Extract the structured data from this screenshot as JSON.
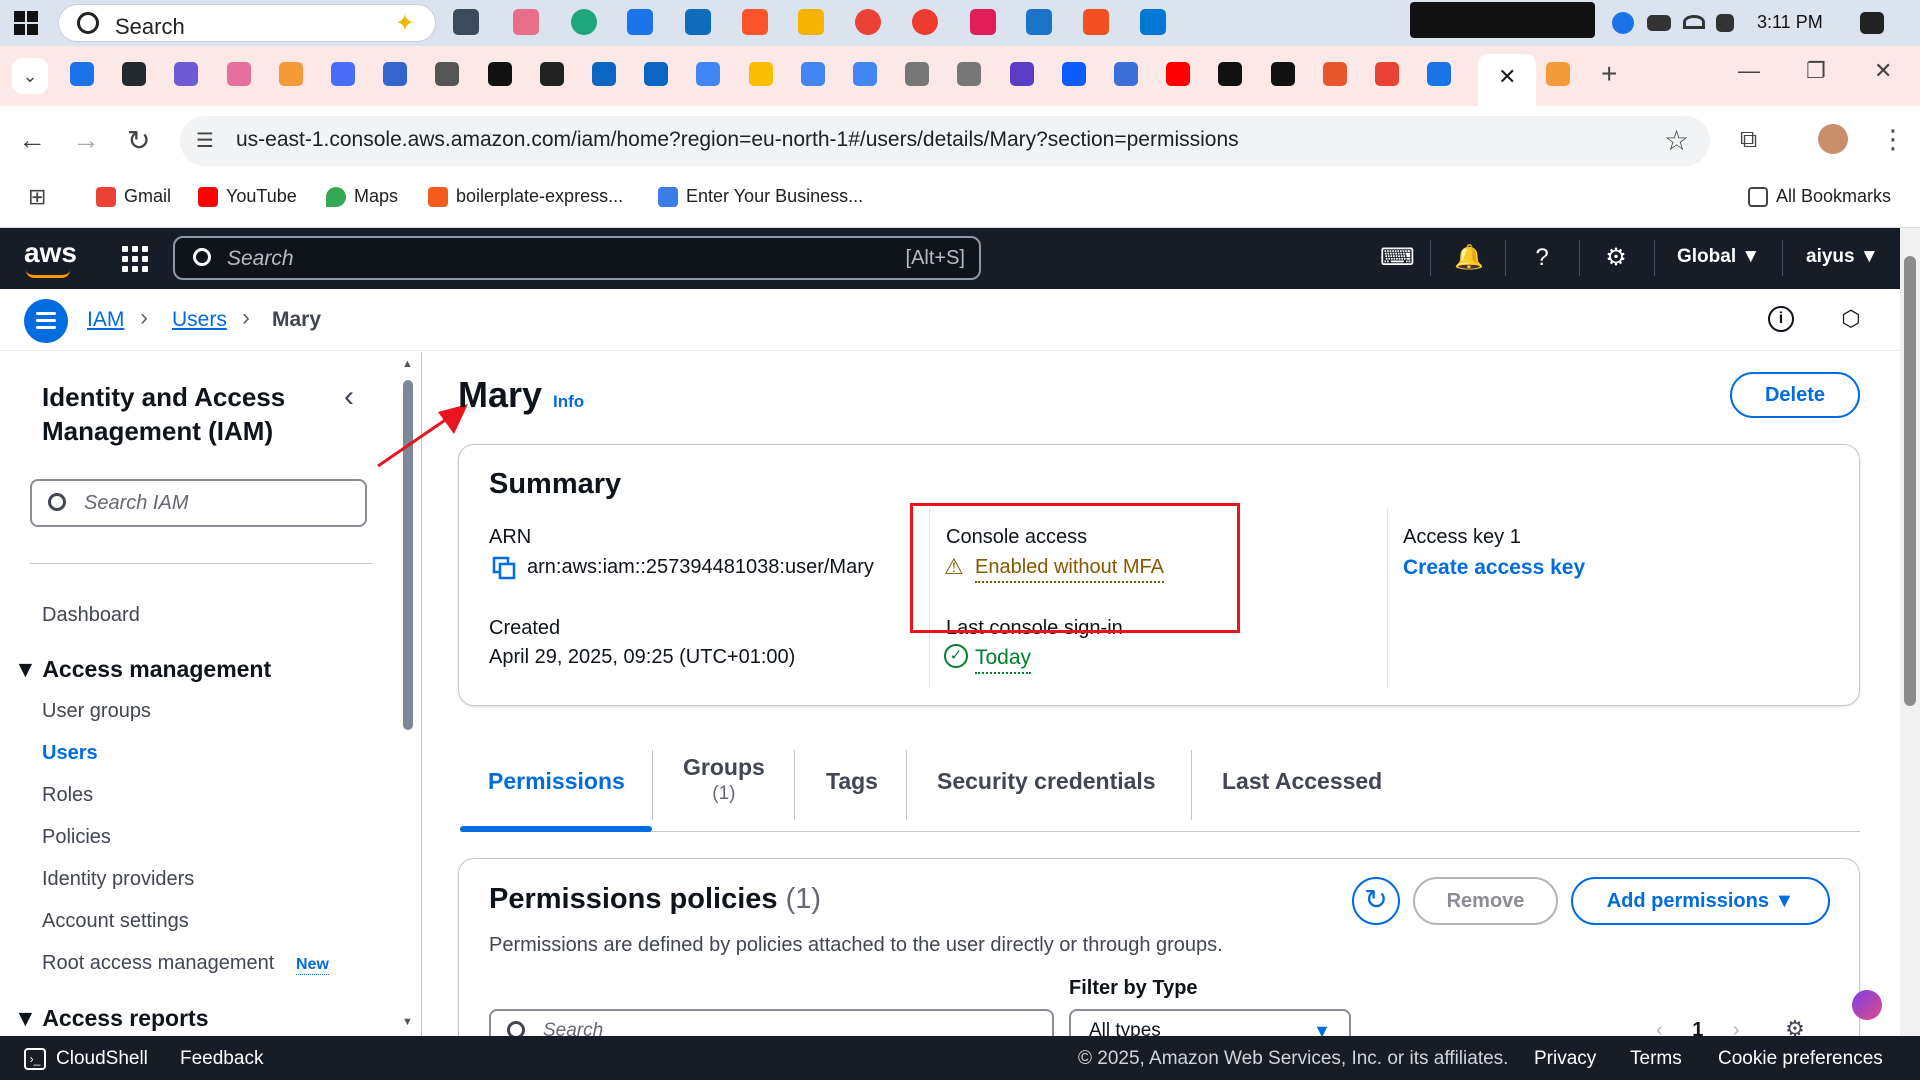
{
  "taskbar": {
    "search_label": "Search",
    "clock": "3:11 PM"
  },
  "browser": {
    "url": "us-east-1.console.aws.amazon.com/iam/home?region=eu-north-1#/users/details/Mary?section=permissions",
    "bookmarks": [
      {
        "label": "Gmail",
        "color": "#ea4335"
      },
      {
        "label": "YouTube",
        "color": "#ff0000"
      },
      {
        "label": "Maps",
        "color": "#34a853"
      },
      {
        "label": "boilerplate-express...",
        "color": "#f25c1f"
      },
      {
        "label": "Enter Your Business...",
        "color": "#3d7be6"
      }
    ],
    "all_bookmarks": "All Bookmarks",
    "tab_favicon_colors": [
      "#1a73e8",
      "#24292f",
      "#6e5bd3",
      "#e66fa0",
      "#f29b38",
      "#4a6cf7",
      "#3366cc",
      "#555",
      "#111",
      "#222",
      "#0a66c2",
      "#0a66c2",
      "#4285f4",
      "#fbbc04",
      "#4285f4",
      "#4285f4",
      "#777",
      "#777",
      "#5b3cc4",
      "#0b5cff",
      "#3a6fd8",
      "#ff0000",
      "#111",
      "#111",
      "#e8572c",
      "#ea4335",
      "#1a73e8",
      "#f29b38"
    ]
  },
  "aws_nav": {
    "logo": "aws",
    "search_placeholder": "Search",
    "search_shortcut": "[Alt+S]",
    "region": "Global ▼",
    "account": "aiyus ▼"
  },
  "breadcrumb": {
    "items": [
      "IAM",
      "Users",
      "Mary"
    ]
  },
  "sidebar": {
    "title": "Identity and Access Management (IAM)",
    "search_placeholder": "Search IAM",
    "dashboard": "Dashboard",
    "section_access_management": "Access management",
    "items": [
      "User groups",
      "Users",
      "Roles",
      "Policies",
      "Identity providers",
      "Account settings",
      "Root access management"
    ],
    "new_badge": "New",
    "section_access_reports": "Access reports"
  },
  "main": {
    "title": "Mary",
    "info": "Info",
    "delete_label": "Delete",
    "summary": {
      "heading": "Summary",
      "arn_label": "ARN",
      "arn_value": "arn:aws:iam::257394481038:user/Mary",
      "created_label": "Created",
      "created_value": "April 29, 2025, 09:25 (UTC+01:00)",
      "console_access_label": "Console access",
      "console_access_value": "Enabled without MFA",
      "last_signin_label": "Last console sign-in",
      "last_signin_value": "Today",
      "access_key_label": "Access key 1",
      "access_key_action": "Create access key"
    },
    "tabs": [
      {
        "label": "Permissions",
        "count": ""
      },
      {
        "label": "Groups",
        "count": "(1)"
      },
      {
        "label": "Tags",
        "count": ""
      },
      {
        "label": "Security credentials",
        "count": ""
      },
      {
        "label": "Last Accessed",
        "count": ""
      }
    ],
    "permissions": {
      "heading": "Permissions policies",
      "count": "(1)",
      "description": "Permissions are defined by policies attached to the user directly or through groups.",
      "remove_label": "Remove",
      "add_label": "Add permissions ▼",
      "filter_label": "Filter by Type",
      "search_placeholder": "Search",
      "type_value": "All types",
      "page": "1"
    }
  },
  "footer": {
    "cloudshell": "CloudShell",
    "feedback": "Feedback",
    "copyright": "© 2025, Amazon Web Services, Inc. or its affiliates.",
    "privacy": "Privacy",
    "terms": "Terms",
    "cookies": "Cookie preferences"
  },
  "colors": {
    "aws_nav_bg": "#161d26",
    "link_blue": "#006ce0",
    "warning": "#855900",
    "success": "#00802f",
    "annotation_red": "#e8141f"
  }
}
